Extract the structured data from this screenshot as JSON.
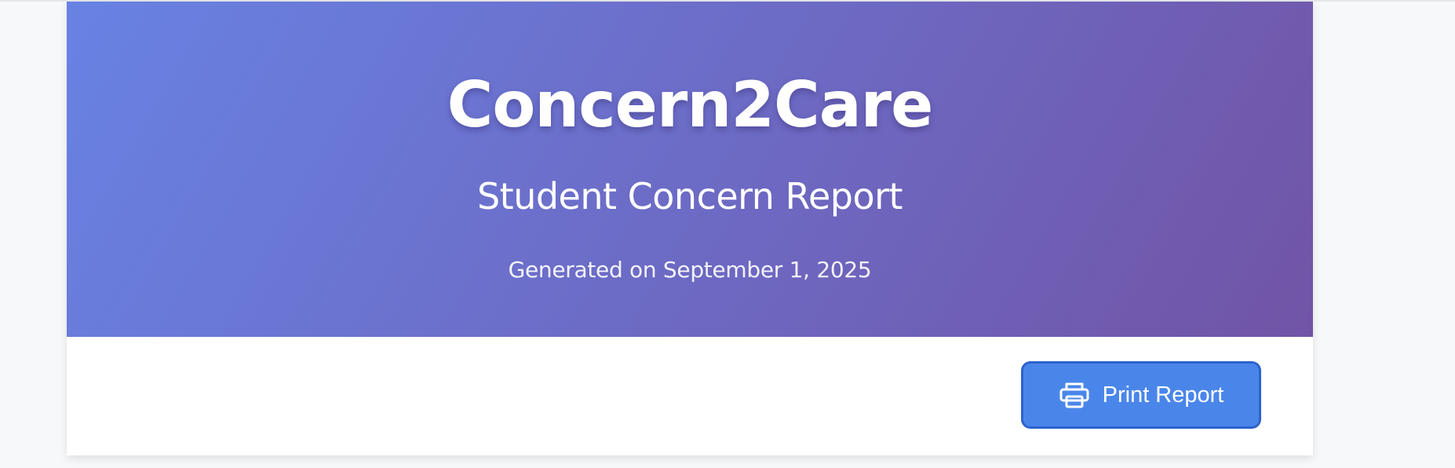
{
  "header": {
    "app_title": "Concern2Care",
    "subtitle": "Student Concern Report",
    "generated": "Generated on September 1, 2025"
  },
  "actions": {
    "print_label": "Print Report",
    "print_icon": "printer-icon"
  },
  "colors": {
    "header_gradient_start": "#6882e3",
    "header_gradient_end": "#7154a6",
    "button_background": "#4a86ea",
    "button_border": "#2e62cc"
  }
}
